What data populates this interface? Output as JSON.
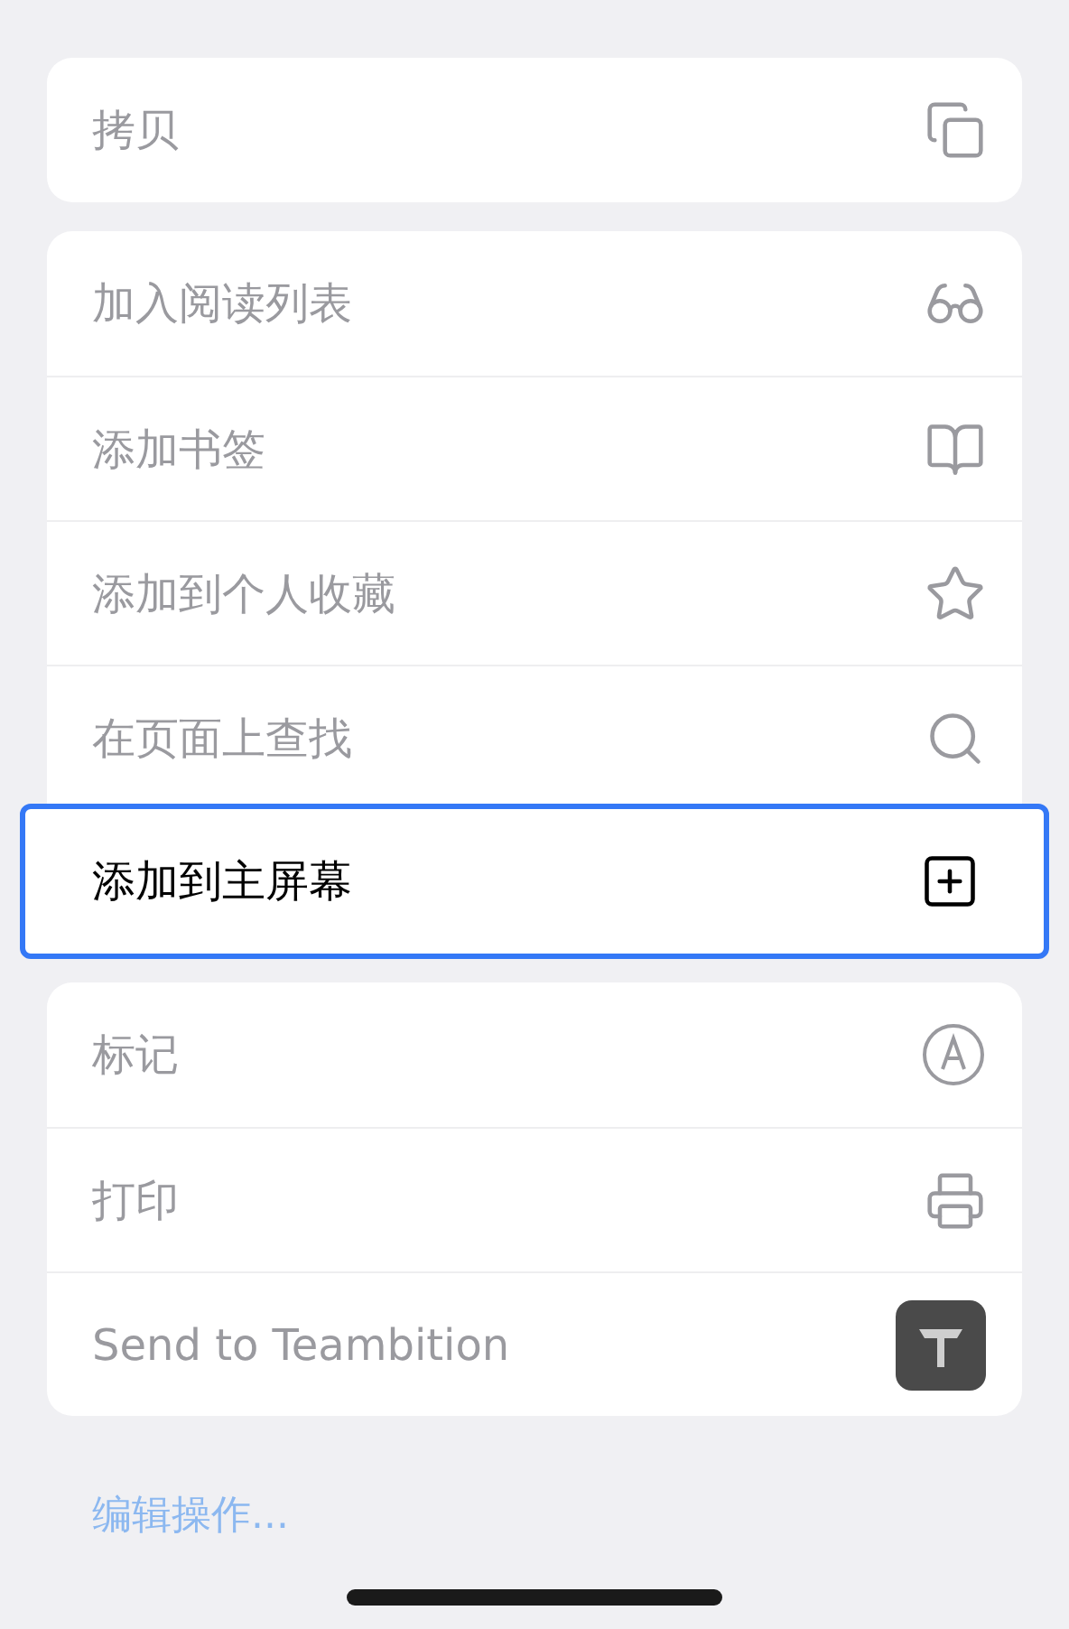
{
  "groups": [
    {
      "items": [
        {
          "label": "拷贝",
          "kind": "copy",
          "selected": false
        }
      ]
    },
    {
      "items": [
        {
          "label": "加入阅读列表",
          "kind": "glasses",
          "selected": false
        },
        {
          "label": "添加书签",
          "kind": "book",
          "selected": false
        },
        {
          "label": "添加到个人收藏",
          "kind": "star",
          "selected": false
        },
        {
          "label": "在页面上查找",
          "kind": "search",
          "selected": false
        },
        {
          "label": "添加到主屏幕",
          "kind": "add",
          "selected": true
        }
      ]
    },
    {
      "items": [
        {
          "label": "标记",
          "kind": "markup",
          "selected": false
        },
        {
          "label": "打印",
          "kind": "print",
          "selected": false
        },
        {
          "label": "Send to Teambition",
          "kind": "app",
          "selected": false
        }
      ]
    }
  ],
  "edit_link": "编辑操作..."
}
